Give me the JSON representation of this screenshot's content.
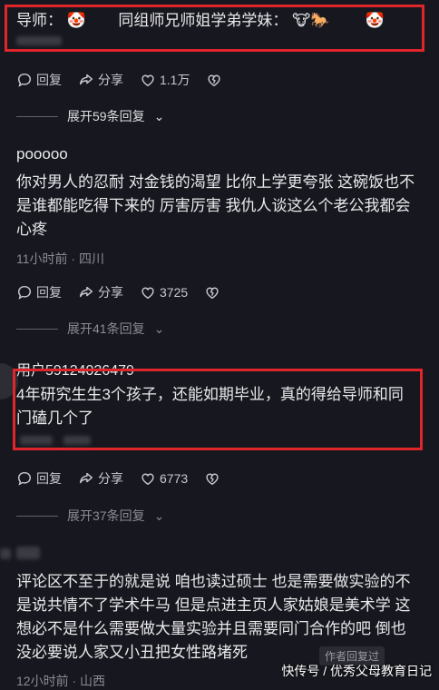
{
  "top": {
    "advisor_label": "导师：",
    "advisor_emoji": "🤡",
    "peers_label": "同组师兄师姐学弟学妹：",
    "peers_emoji": "🐮🐎",
    "peers_emoji2": "🤡"
  },
  "c1": {
    "reply": "回复",
    "share": "分享",
    "likes": "1.1万"
  },
  "expand1": {
    "text": "展开59条回复"
  },
  "c2": {
    "user": "pooooo",
    "text": "你对男人的忍耐 对金钱的渴望 比你上学更夸张 这碗饭也不是谁都能吃得下来的 厉害厉害 我仇人谈这么个老公我都会心疼",
    "meta": "11小时前 · 四川",
    "reply": "回复",
    "share": "分享",
    "likes": "3725"
  },
  "expand2": {
    "text": "展开41条回复"
  },
  "c3": {
    "user": "用户59124026479",
    "text": "4年研究生生3个孩子，还能如期毕业，真的得给导师和同门磕几个了",
    "reply": "回复",
    "share": "分享",
    "likes": "6773"
  },
  "expand3": {
    "text": "展开37条回复"
  },
  "c4": {
    "text": "评论区不至于的就是说  咱也读过硕士 也是需要做实验的不是说共情不了学术牛马  但是点进主页人家姑娘是美术学  这想必不是什么需要做大量实验并且需要同门合作的吧  倒也没必要说人家又小丑把女性路堵死",
    "author_badge": "作者回复过",
    "meta": "12小时前 · 山西"
  },
  "watermark": {
    "text": "快传号 / 优秀父母教育日记"
  },
  "colors": {
    "red_box": "#e0252b",
    "bg": "#17181f"
  }
}
